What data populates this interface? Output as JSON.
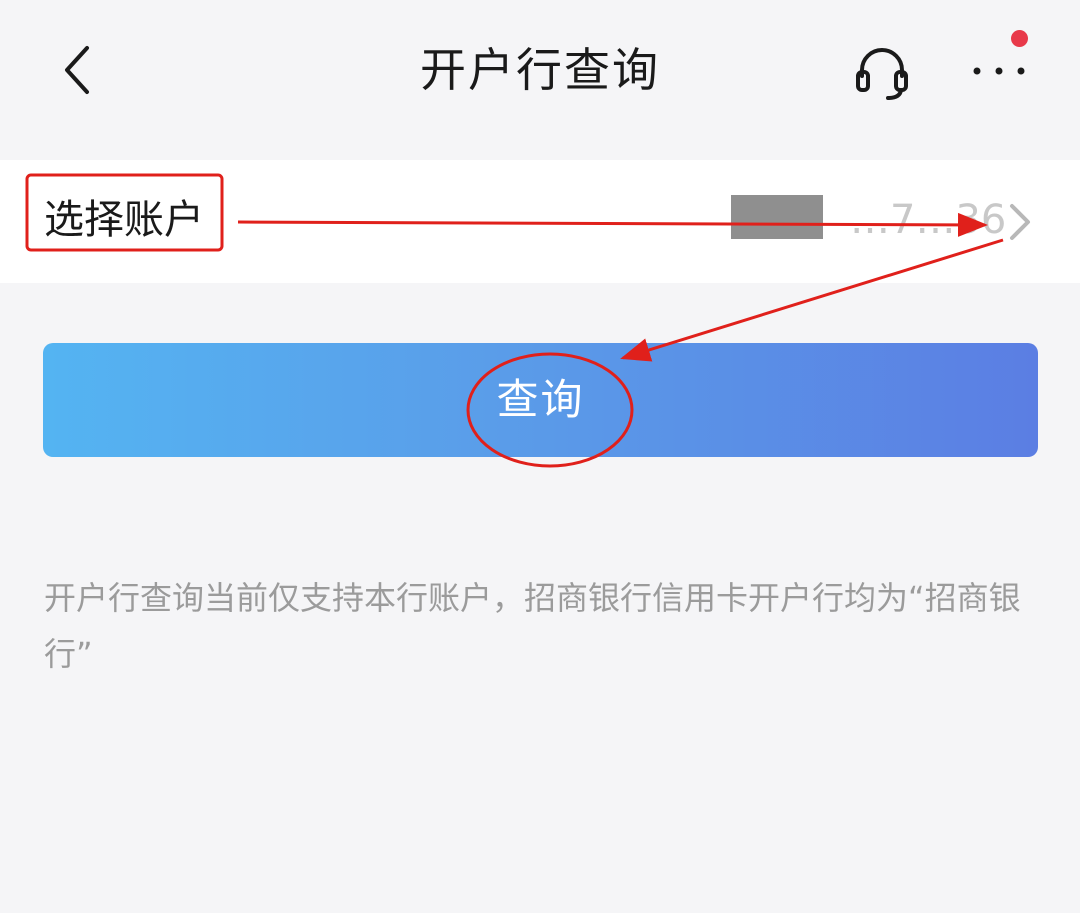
{
  "header": {
    "title": "开户行查询",
    "back_icon": "chevron-left-icon",
    "support_icon": "headset-icon",
    "more_icon": "more-dots-icon",
    "notification_dot_color": "#e8394a"
  },
  "account": {
    "label": "选择账户",
    "number_partial": "…7…36",
    "chevron_icon": "chevron-right-icon"
  },
  "query_button": {
    "label": "查询",
    "gradient_start": "#54b4f2",
    "gradient_end": "#5b7ee3"
  },
  "notice": {
    "text": "开户行查询当前仅支持本行账户，招商银行信用卡开户行均为“招商银行”"
  },
  "annotation_color": "#e0201b"
}
